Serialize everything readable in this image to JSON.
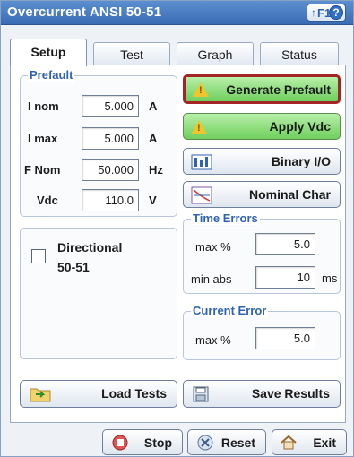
{
  "window": {
    "title": "Overcurrent ANSI 50-51",
    "help_arrow": "↑",
    "help_key": "F1",
    "help_icon_glyph": "?"
  },
  "tabs": [
    {
      "label": "Setup",
      "active": true
    },
    {
      "label": "Test",
      "active": false
    },
    {
      "label": "Graph",
      "active": false
    },
    {
      "label": "Status",
      "active": false
    }
  ],
  "prefault": {
    "title": "Prefault",
    "rows": [
      {
        "label": "I nom",
        "value": "5.000",
        "unit": "A"
      },
      {
        "label": "I max",
        "value": "5.000",
        "unit": "A"
      },
      {
        "label": "F Nom",
        "value": "50.000",
        "unit": "Hz"
      },
      {
        "label": "Vdc",
        "value": "110.0",
        "unit": "V"
      }
    ]
  },
  "buttons": {
    "generate_prefault": "Generate Prefault",
    "apply_vdc": "Apply Vdc",
    "binary_io": "Binary I/O",
    "nominal_char": "Nominal Char",
    "load_tests": "Load Tests",
    "save_results": "Save Results",
    "stop": "Stop",
    "reset": "Reset",
    "exit": "Exit"
  },
  "directional": {
    "label_line1": "Directional",
    "label_line2": "50-51",
    "checked": false
  },
  "time_errors": {
    "title": "Time Errors",
    "max_label": "max %",
    "max_value": "5.0",
    "min_label": "min abs",
    "min_value": "10",
    "min_unit": "ms"
  },
  "current_error": {
    "title": "Current Error",
    "max_label": "max %",
    "max_value": "5.0"
  },
  "colors": {
    "title_bar": "#3a6cb4",
    "accent": "#2f63b1",
    "green_button": "#6fcf5d",
    "warning_border": "#a32525"
  }
}
